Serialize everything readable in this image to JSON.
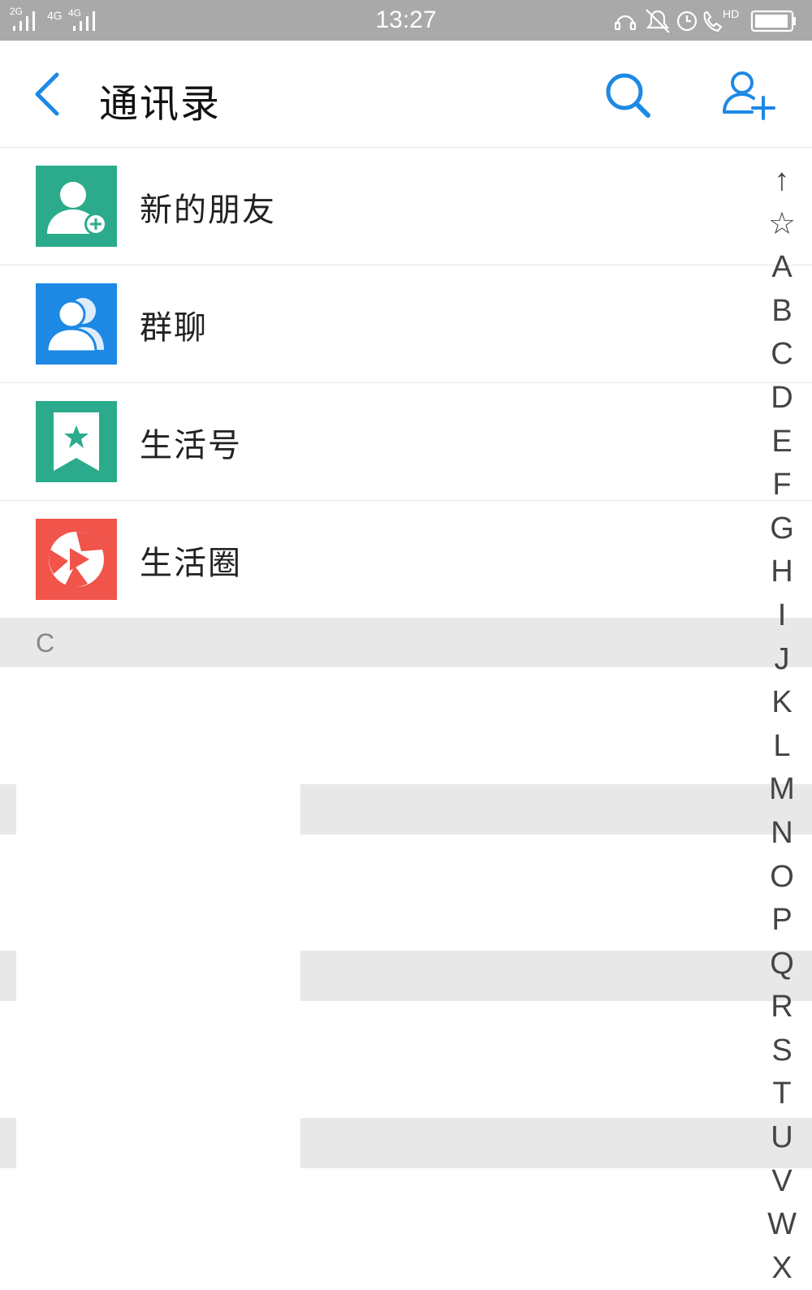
{
  "status_bar": {
    "time": "13:27",
    "network_1": "2G",
    "network_2": "4G",
    "network_3": "4G",
    "hd_label": "HD"
  },
  "header": {
    "title": "通讯录",
    "back_icon": "chevron-left-icon",
    "search_icon": "search-icon",
    "add_icon": "add-contact-icon"
  },
  "entries": [
    {
      "label": "新的朋友",
      "icon": "new-friend-icon",
      "color": "#2bab8b"
    },
    {
      "label": "群聊",
      "icon": "group-chat-icon",
      "color": "#1e88e5"
    },
    {
      "label": "生活号",
      "icon": "life-account-icon",
      "color": "#2bab8b"
    },
    {
      "label": "生活圈",
      "icon": "life-circle-icon",
      "color": "#f0544a"
    }
  ],
  "section": {
    "letter": "C"
  },
  "index_bar": [
    "↑",
    "☆",
    "A",
    "B",
    "C",
    "D",
    "E",
    "F",
    "G",
    "H",
    "I",
    "J",
    "K",
    "L",
    "M",
    "N",
    "O",
    "P",
    "Q",
    "R",
    "S",
    "T",
    "U",
    "V",
    "W",
    "X"
  ],
  "colors": {
    "accent": "#1e88e5",
    "status_bar": "#a9a9a9",
    "section_bg": "#e8e8e8"
  }
}
